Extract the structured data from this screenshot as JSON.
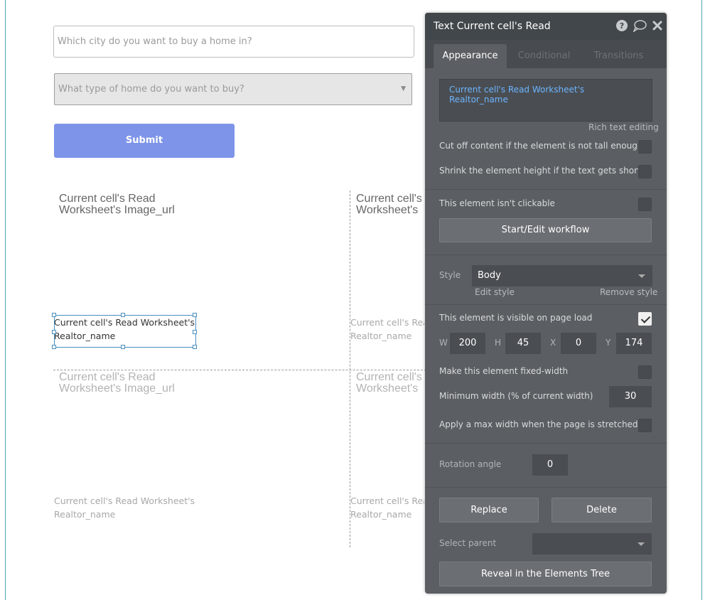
{
  "form": {
    "city_placeholder": "Which city do you want to buy a home in?",
    "home_type_placeholder": "What type of home do you want to buy?",
    "submit_label": "Submit"
  },
  "repeating_group": {
    "image_url_line1": "Current cell's Read",
    "image_url_line2": "Worksheet's Image_url",
    "image_url_trunc_line1": "Current cell's",
    "image_url_trunc_line2": "Worksheet's I",
    "realtor_line1": "Current cell's Read Worksheet's",
    "realtor_line2": "Realtor_name",
    "realtor_trunc_line1": "Current cell's Rea",
    "realtor_trunc_line2": "Realtor_name"
  },
  "panel": {
    "title": "Text Current cell's Read",
    "tabs": [
      "Appearance",
      "Conditional",
      "Transitions"
    ],
    "content_value": "Current cell's Read Worksheet's Realtor_name",
    "rich_text_link": "Rich text editing",
    "cut_off_label": "Cut off content if the element is not tall enough",
    "shrink_label": "Shrink the element height if the text gets shorter",
    "not_clickable_label": "This element isn't clickable",
    "workflow_button": "Start/Edit workflow",
    "style_label": "Style",
    "style_value": "Body",
    "edit_style": "Edit style",
    "remove_style": "Remove style",
    "visible_label": "This element is visible on page load",
    "dims": {
      "w_label": "W",
      "w": "200",
      "h_label": "H",
      "h": "45",
      "x_label": "X",
      "x": "0",
      "y_label": "Y",
      "y": "174"
    },
    "fixed_width_label": "Make this element fixed-width",
    "min_width_label": "Minimum width (% of current width)",
    "min_width_value": "30",
    "max_width_label": "Apply a max width when the page is stretched",
    "rotation_label": "Rotation angle",
    "rotation_value": "0",
    "replace_button": "Replace",
    "delete_button": "Delete",
    "select_parent_label": "Select parent",
    "reveal_button": "Reveal in the Elements Tree"
  },
  "icons": {
    "help": "help-icon",
    "comment": "comment-icon",
    "close": "close-icon"
  },
  "colors": {
    "accent_submit": "#7e94e8",
    "panel_bg": "#5b5f63",
    "link_blue": "#6cb4ff"
  }
}
